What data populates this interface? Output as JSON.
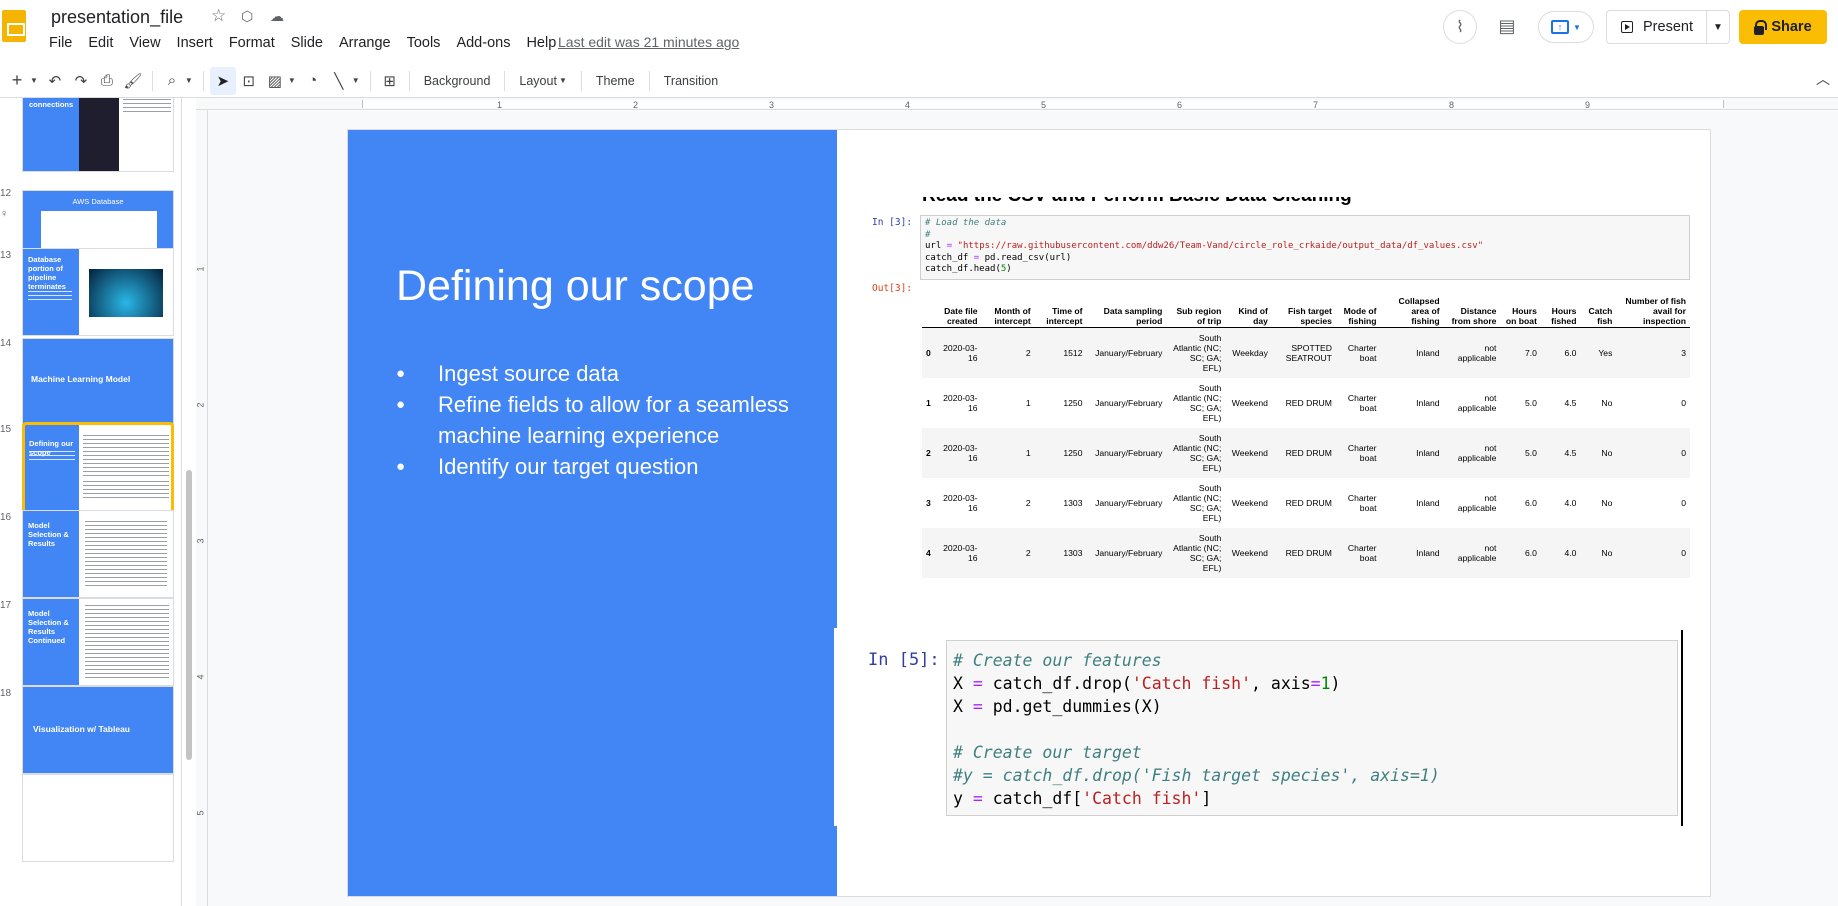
{
  "header": {
    "doc_title": "presentation_file",
    "menu": [
      "File",
      "Edit",
      "View",
      "Insert",
      "Format",
      "Slide",
      "Arrange",
      "Tools",
      "Add-ons",
      "Help"
    ],
    "last_edit": "Last edit was 21 minutes ago",
    "present_label": "Present",
    "share_label": "Share"
  },
  "toolbar": {
    "background_label": "Background",
    "layout_label": "Layout",
    "theme_label": "Theme",
    "transition_label": "Transition"
  },
  "filmstrip": {
    "slides": [
      {
        "num": "",
        "title": "Database connections"
      },
      {
        "num": "12",
        "title": "AWS Database"
      },
      {
        "num": "13",
        "title": "Database portion of pipeline terminates"
      },
      {
        "num": "14",
        "title": "Machine Learning Model"
      },
      {
        "num": "15",
        "title": "Defining our scope"
      },
      {
        "num": "16",
        "title": "Model Selection & Results"
      },
      {
        "num": "17",
        "title": "Model Selection & Results Continued"
      },
      {
        "num": "18",
        "title": "Visualization w/ Tableau"
      }
    ]
  },
  "ruler": {
    "top": [
      "1",
      "2",
      "3",
      "4",
      "5",
      "6",
      "7",
      "8",
      "9"
    ],
    "left": [
      "1",
      "2",
      "3",
      "4",
      "5"
    ]
  },
  "slide": {
    "title": "Defining our scope",
    "bullets": [
      "Ingest source data",
      "Refine fields to allow for a seamless machine learning experience",
      "Identify our target question"
    ]
  },
  "notebook1": {
    "heading": "Read the CSV and Perform Basic Data Cleaning",
    "in_prompt": "In [3]:",
    "out_prompt": "Out[3]:",
    "columns": [
      "",
      "Date file created",
      "Month of intercept",
      "Time of intercept",
      "Data sampling period",
      "Sub region of trip",
      "Kind of day",
      "Fish target species",
      "Mode of fishing",
      "Collapsed area of fishing",
      "Distance from shore",
      "Hours on boat",
      "Hours fished",
      "Catch fish",
      "Number of fish avail for inspection"
    ],
    "rows": [
      [
        "0",
        "2020-03-16",
        "2",
        "1512",
        "January/February",
        "South Atlantic (NC; SC; GA; EFL)",
        "Weekday",
        "SPOTTED SEATROUT",
        "Charter boat",
        "Inland",
        "not applicable",
        "7.0",
        "6.0",
        "Yes",
        "3"
      ],
      [
        "1",
        "2020-03-16",
        "1",
        "1250",
        "January/February",
        "South Atlantic (NC; SC; GA; EFL)",
        "Weekend",
        "RED DRUM",
        "Charter boat",
        "Inland",
        "not applicable",
        "5.0",
        "4.5",
        "No",
        "0"
      ],
      [
        "2",
        "2020-03-16",
        "1",
        "1250",
        "January/February",
        "South Atlantic (NC; SC; GA; EFL)",
        "Weekend",
        "RED DRUM",
        "Charter boat",
        "Inland",
        "not applicable",
        "5.0",
        "4.5",
        "No",
        "0"
      ],
      [
        "3",
        "2020-03-16",
        "2",
        "1303",
        "January/February",
        "South Atlantic (NC; SC; GA; EFL)",
        "Weekend",
        "RED DRUM",
        "Charter boat",
        "Inland",
        "not applicable",
        "6.0",
        "4.0",
        "No",
        "0"
      ],
      [
        "4",
        "2020-03-16",
        "2",
        "1303",
        "January/February",
        "South Atlantic (NC; SC; GA; EFL)",
        "Weekend",
        "RED DRUM",
        "Charter boat",
        "Inland",
        "not applicable",
        "6.0",
        "4.0",
        "No",
        "0"
      ]
    ]
  },
  "notebook2": {
    "prompt": "In [5]:"
  },
  "colors": {
    "slide_blue": "#4285f4",
    "share_yellow": "#fbbc04",
    "selected_thumb_border": "#fbbc04"
  }
}
